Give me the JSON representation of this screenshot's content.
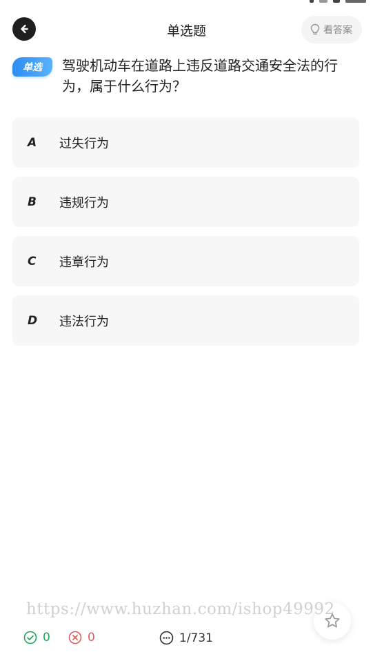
{
  "header": {
    "title": "单选题",
    "show_answer_label": "看答案"
  },
  "question": {
    "type_badge": "单选",
    "text": "驾驶机动车在道路上违反道路交通安全法的行为，属于什么行为？"
  },
  "options": [
    {
      "letter": "A",
      "text": "过失行为"
    },
    {
      "letter": "B",
      "text": "违规行为"
    },
    {
      "letter": "C",
      "text": "违章行为"
    },
    {
      "letter": "D",
      "text": "违法行为"
    }
  ],
  "watermark": "https://www.huzhan.com/ishop49992",
  "stats": {
    "correct_count": "0",
    "wrong_count": "0",
    "progress": "1/731"
  },
  "colors": {
    "badge_blue": "#2d8cf0",
    "correct_green": "#22a559",
    "wrong_red": "#e35b5b",
    "option_bg": "#f7f7f7"
  },
  "icons": {
    "back": "arrow-left-icon",
    "hint": "lightbulb-icon",
    "correct": "check-circle-icon",
    "wrong": "x-circle-icon",
    "progress": "dots-circle-icon",
    "favorite": "star-icon"
  }
}
